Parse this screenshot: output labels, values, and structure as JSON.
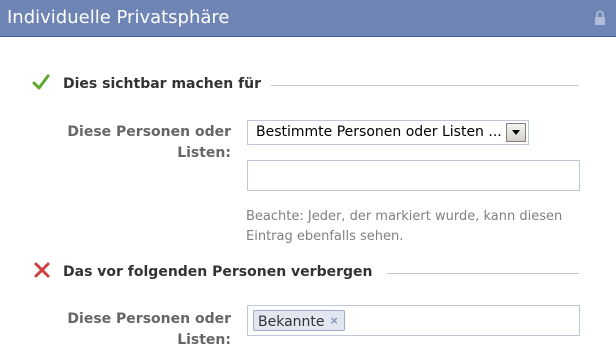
{
  "dialog": {
    "title": "Individuelle Privatsphäre",
    "lock_icon": "lock-icon"
  },
  "show_section": {
    "icon": "check-icon",
    "icon_color": "#5fa82d",
    "title": "Dies sichtbar machen für",
    "field_label": "Diese Personen oder Listen:",
    "select_value": "Bestimmte Personen oder Listen ...",
    "input_value": "",
    "note": "Beachte: Jeder, der markiert wurde, kann diesen Eintrag ebenfalls sehen."
  },
  "hide_section": {
    "icon": "cross-icon",
    "icon_color": "#d04040",
    "title": "Das vor folgenden Personen verbergen",
    "field_label": "Diese Personen oder Listen:",
    "tokens": [
      {
        "label": "Bekannte",
        "remove": "×"
      }
    ]
  },
  "colors": {
    "header_bg": "#6d84b4",
    "input_border": "#bdc7d8",
    "token_bg": "#e2e6f0"
  }
}
